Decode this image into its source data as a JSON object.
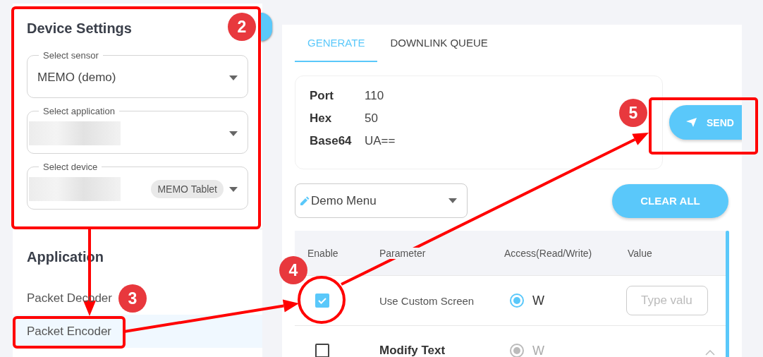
{
  "sidebar": {
    "device_settings": {
      "title": "Device Settings",
      "fields": [
        {
          "label": "Select sensor",
          "value": "MEMO (demo)",
          "redacted": false
        },
        {
          "label": "Select application",
          "redacted": true
        },
        {
          "label": "Select device",
          "redacted": true,
          "chip": "MEMO Tablet"
        }
      ]
    },
    "application": {
      "title": "Application",
      "items": [
        {
          "label": "Packet Decoder",
          "selected": false
        },
        {
          "label": "Packet Encoder",
          "selected": true
        }
      ]
    }
  },
  "main": {
    "tabs": [
      {
        "label": "GENERATE",
        "selected": true
      },
      {
        "label": "DOWNLINK QUEUE",
        "selected": false
      }
    ],
    "packet": [
      {
        "label": "Port",
        "value": "110"
      },
      {
        "label": "Hex",
        "value": "50"
      },
      {
        "label": "Base64",
        "value": "UA=="
      }
    ],
    "send_button": "SEND",
    "menu_select": {
      "value": "Demo Menu"
    },
    "clear_button": "CLEAR ALL",
    "table": {
      "columns": [
        "Enable",
        "Parameter",
        "Access(Read/Write)",
        "Value"
      ],
      "rows": [
        {
          "kind": "param",
          "checked": true,
          "parameter": "Use Custom Screen",
          "access": "W",
          "access_selected": true,
          "access_disabled": false,
          "placeholder": "Type valu"
        },
        {
          "kind": "group",
          "checked": false,
          "parameter": "Modify Text",
          "access": "W",
          "access_selected": true,
          "access_disabled": true,
          "expanded": true
        }
      ]
    }
  },
  "annotations": {
    "badges": [
      "2",
      "3",
      "4",
      "5"
    ]
  }
}
